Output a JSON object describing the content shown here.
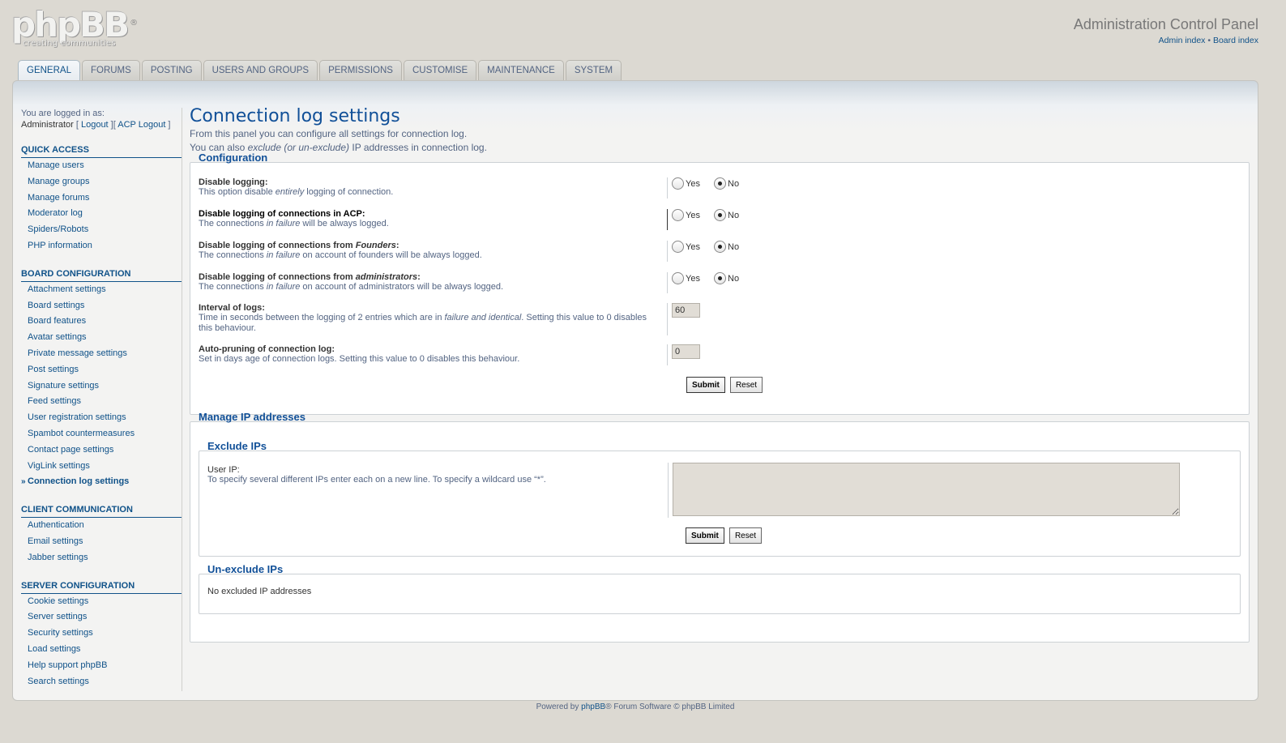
{
  "logo": {
    "brand": "phpBB",
    "reg": "®",
    "tagline": "creating communities"
  },
  "header": {
    "title": "Administration Control Panel",
    "links": {
      "admin_index": "Admin index",
      "sep": "•",
      "board_index": "Board index"
    }
  },
  "tabs": [
    "General",
    "Forums",
    "Posting",
    "Users and Groups",
    "Permissions",
    "Customise",
    "Maintenance",
    "System"
  ],
  "sidebar": {
    "logged_in_as": "You are logged in as:",
    "username": "Administrator",
    "logout": "Logout",
    "acp_logout": "ACP Logout",
    "sections": [
      {
        "title": "Quick access",
        "items": [
          "Manage users",
          "Manage groups",
          "Manage forums",
          "Moderator log",
          "Spiders/Robots",
          "PHP information"
        ]
      },
      {
        "title": "Board configuration",
        "items": [
          "Attachment settings",
          "Board settings",
          "Board features",
          "Avatar settings",
          "Private message settings",
          "Post settings",
          "Signature settings",
          "Feed settings",
          "User registration settings",
          "Spambot countermeasures",
          "Contact page settings",
          "VigLink settings",
          "Connection log settings"
        ]
      },
      {
        "title": "Client communication",
        "items": [
          "Authentication",
          "Email settings",
          "Jabber settings"
        ]
      },
      {
        "title": "Server configuration",
        "items": [
          "Cookie settings",
          "Server settings",
          "Security settings",
          "Load settings",
          "Help support phpBB",
          "Search settings"
        ]
      }
    ]
  },
  "main": {
    "title": "Connection log settings",
    "intro1": "From this panel you can configure all settings for connection log.",
    "intro2_a": "You can also ",
    "intro2_em": "exclude (or un-exclude)",
    "intro2_b": " IP addresses in connection log.",
    "config": {
      "legend": "Configuration",
      "disable_logging": {
        "title": "Disable logging:",
        "d1": "This option disable ",
        "d_em": "entirely",
        "d2": " logging of connection.",
        "yes": "Yes",
        "no": "No"
      },
      "disable_acp": {
        "title": "Disable logging of connections in ACP:",
        "d1": "The connections ",
        "d_em": "in failure",
        "d2": " will be always logged.",
        "yes": "Yes",
        "no": "No"
      },
      "disable_founders": {
        "title1": "Disable logging of connections from ",
        "title_em": "Founders",
        "title2": ":",
        "d1": "The connections ",
        "d_em": "in failure",
        "d2": " on account of founders will be always logged.",
        "yes": "Yes",
        "no": "No"
      },
      "disable_admins": {
        "title1": "Disable logging of connections from ",
        "title_em": "administrators",
        "title2": ":",
        "d1": "The connections ",
        "d_em": "in failure",
        "d2": " on account of administrators will be always logged.",
        "yes": "Yes",
        "no": "No"
      },
      "interval": {
        "title": "Interval of logs:",
        "d1": "Time in seconds between the logging of 2 entries which are in ",
        "d_em": "failure and identical",
        "d2": ". Setting this value to 0 disables this behaviour.",
        "value": "60"
      },
      "pruning": {
        "title": "Auto-pruning of connection log:",
        "d": "Set in days age of connection logs. Setting this value to 0 disables this behaviour.",
        "value": "0"
      },
      "submit": "Submit",
      "reset": "Reset"
    },
    "ip": {
      "legend": "Manage IP addresses",
      "exclude_legend": "Exclude IPs",
      "user_ip_title": "User IP:",
      "user_ip_desc": "To specify several different IPs enter each on a new line. To specify a wildcard use “*”.",
      "submit": "Submit",
      "reset": "Reset",
      "unexclude_legend": "Un-exclude IPs",
      "no_excluded": "No excluded IP addresses"
    }
  },
  "footer": {
    "powered_by": "Powered by ",
    "phpbb": "phpBB",
    "rest": "® Forum Software © phpBB Limited"
  }
}
